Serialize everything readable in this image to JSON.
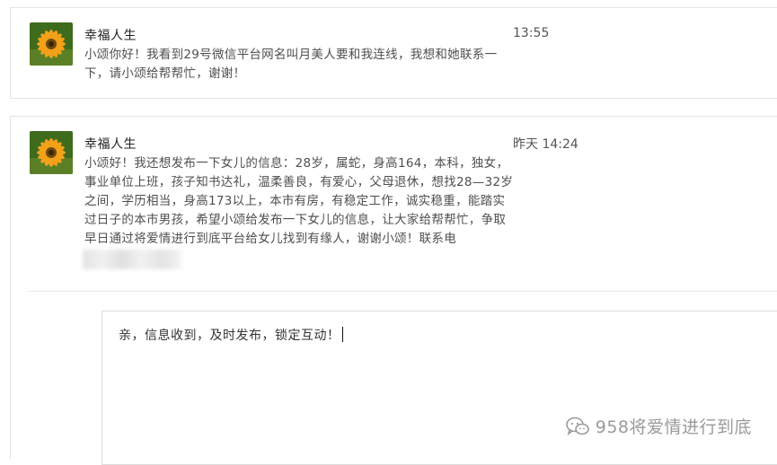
{
  "messages": [
    {
      "sender": "幸福人生",
      "time": "13:55",
      "avatar_icon": "flower-avatar-icon",
      "text": "小颂你好！我看到29号微信平台网名叫月美人要和我连线，我想和她联系一下，请小颂给帮帮忙，谢谢！"
    },
    {
      "sender": "幸福人生",
      "time": "昨天 14:24",
      "avatar_icon": "flower-avatar-icon",
      "text": "小颂好！我还想发布一下女儿的信息：28岁，属蛇，身高164，本科，独女，事业单位上班，孩子知书达礼，温柔善良，有爱心，父母退休，想找28—32岁之间，学历相当，身高173以上，本市有房，有稳定工作，诚实稳重，能踏实过日子的本市男孩，希望小颂给发布一下女儿的信息，让大家给帮帮忙，争取早日通过将爱情进行到底平台给女儿找到有缘人，谢谢小颂！联系电"
    }
  ],
  "reply": {
    "text": "亲，信息收到，及时发布，锁定互动！"
  },
  "watermark": {
    "text": "958将爱情进行到底",
    "icon": "wechat-icon"
  },
  "colors": {
    "avatar_petal": "#f4a11a",
    "avatar_center": "#6b4a12",
    "avatar_bg": "#3f6b1c"
  }
}
